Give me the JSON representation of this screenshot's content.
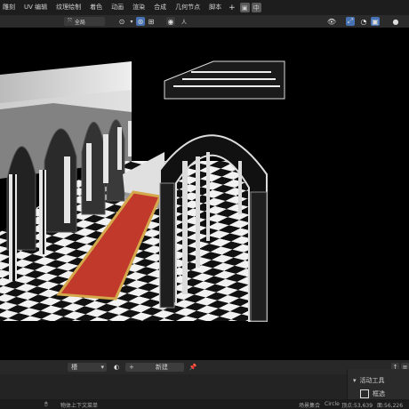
{
  "menu": {
    "tabs": [
      "雕刻",
      "UV 编辑",
      "纹理绘制",
      "着色",
      "动画",
      "渲染",
      "合成",
      "几何节点",
      "脚本"
    ],
    "add_label": "+",
    "scene_btn_label": "中"
  },
  "header": {
    "view_mode": "全局",
    "snap_label": "人"
  },
  "timeline": {
    "slot_label": "槽",
    "new_label": "新建"
  },
  "tool_panel": {
    "title": "活动工具",
    "item": "框选"
  },
  "status": {
    "left_text": "物体上下文菜单",
    "scene": "场景集合",
    "object": "Circle",
    "stats1": "顶点:53,639",
    "stats2": "面:56,226"
  },
  "colors": {
    "accent": "#4772b3",
    "carpet": "#c0392b",
    "carpet_trim": "#d4a84b"
  }
}
